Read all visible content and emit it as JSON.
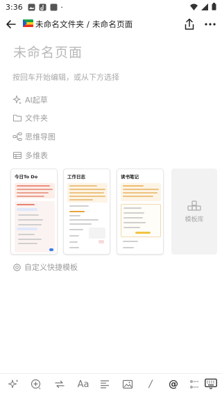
{
  "status": {
    "time": "3:36"
  },
  "header": {
    "breadcrumb": "未命名文件夹 / 未命名页面"
  },
  "page": {
    "title": "未命名页面",
    "hint": "按回车开始编辑，或从下方选择"
  },
  "options": [
    {
      "label": "AI起草",
      "icon": "sparkle-icon"
    },
    {
      "label": "文件夹",
      "icon": "folder-icon"
    },
    {
      "label": "思维导图",
      "icon": "mindmap-icon"
    },
    {
      "label": "多维表",
      "icon": "table-icon"
    }
  ],
  "templates": [
    {
      "title": "今日To Do",
      "accent": "#e0503c"
    },
    {
      "title": "工作日志",
      "accent": "#e8a23a"
    },
    {
      "title": "读书笔记",
      "accent": "#e8a23a"
    }
  ],
  "template_library": {
    "label": "模板库"
  },
  "custom_template": {
    "label": "自定义快捷模板"
  },
  "toolbar": {
    "items": [
      "ai-icon",
      "insert-icon",
      "repeat-icon",
      "Aa",
      "align-icon",
      "image-icon",
      "/",
      "@",
      "checklist-icon",
      "keyboard-icon"
    ],
    "font_label": "Aa",
    "slash_label": "/",
    "at_label": "@"
  },
  "colors": {
    "accent_red": "#e0503c",
    "accent_orange": "#e8a23a",
    "muted": "#9d9d9d"
  }
}
